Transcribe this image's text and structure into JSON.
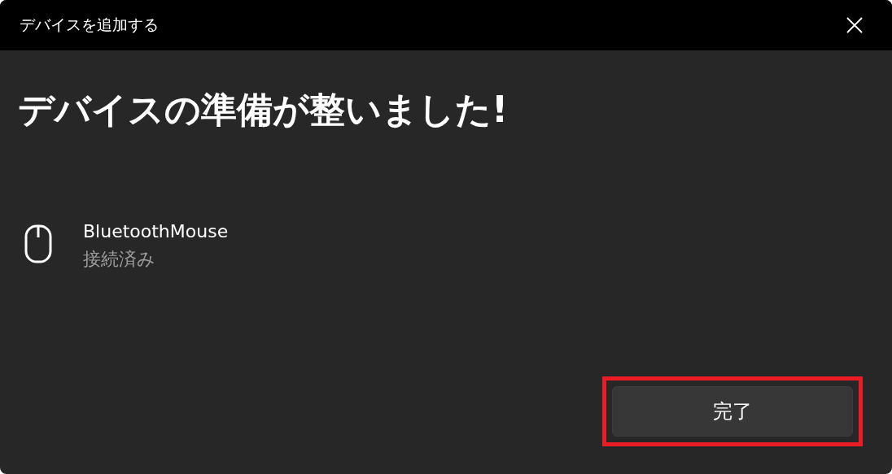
{
  "window": {
    "title": "デバイスを追加する"
  },
  "heading": "デバイスの準備が整いました!",
  "device": {
    "name": "BluetoothMouse",
    "status": "接続済み"
  },
  "buttons": [
    {
      "label": "完了",
      "highlighted": true
    }
  ]
}
